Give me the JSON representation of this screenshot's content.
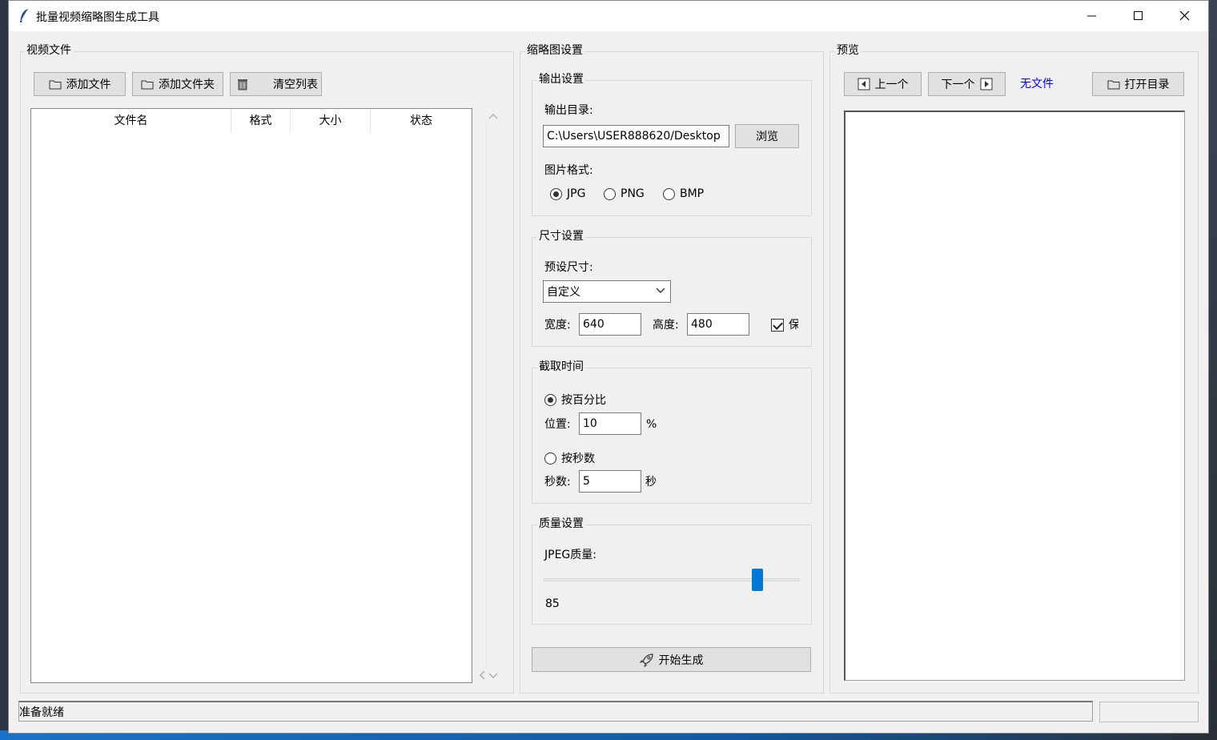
{
  "window": {
    "title": "批量视频缩略图生成工具"
  },
  "files_panel": {
    "label": "视频文件",
    "add_file": "添加文件",
    "add_folder": "添加文件夹",
    "clear_list": "清空列表",
    "columns": [
      "文件名",
      "格式",
      "大小",
      "状态"
    ]
  },
  "settings_panel": {
    "label": "缩略图设置",
    "output": {
      "label": "输出设置",
      "dir_label": "输出目录:",
      "dir_value": "C:\\Users\\USER888620/Desktop",
      "browse": "浏览",
      "format_label": "图片格式:",
      "formats": [
        "JPG",
        "PNG",
        "BMP"
      ],
      "selected_format": "JPG"
    },
    "size": {
      "label": "尺寸设置",
      "preset_label": "预设尺寸:",
      "preset_value": "自定义",
      "width_label": "宽度:",
      "width_value": "640",
      "height_label": "高度:",
      "height_value": "480",
      "keep_ratio_label": "保",
      "keep_ratio_checked": true
    },
    "capture": {
      "label": "截取时间",
      "by_percent": "按百分比",
      "position_label": "位置:",
      "position_value": "10",
      "percent_unit": "%",
      "by_seconds": "按秒数",
      "seconds_label": "秒数:",
      "seconds_value": "5",
      "seconds_unit": "秒",
      "selected_mode": "percent"
    },
    "quality": {
      "label": "质量设置",
      "jpeg_label": "JPEG质量:",
      "value": "85",
      "value_fraction": 0.85
    },
    "start": "开始生成"
  },
  "preview_panel": {
    "label": "预览",
    "prev": "上一个",
    "next": "下一个",
    "no_file": "无文件",
    "open_dir": "打开目录"
  },
  "status": {
    "text": "准备就绪",
    "progress": 0
  },
  "colors": {
    "accent": "#0078d7",
    "link": "#0000ff",
    "window_bg": "#f0f0f0"
  }
}
